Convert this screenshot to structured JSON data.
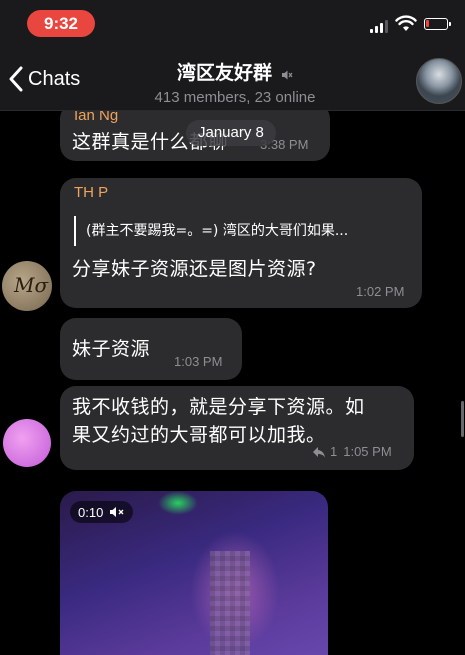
{
  "status_bar": {
    "time": "9:32",
    "battery_color": "#e8463f"
  },
  "nav": {
    "back_label": "Chats",
    "title": "湾区友好群",
    "subtitle": "413 members, 23 online",
    "muted": true
  },
  "chat": {
    "date_label": "January 8",
    "messages": [
      {
        "sender": "Ian Ng",
        "text": "这群真是什么都聊",
        "time": "3:38 PM"
      },
      {
        "sender": "TH P",
        "avatar_text": "Mσ",
        "quote": "(群主不要踢我=。=) 湾区的大哥们如果...",
        "text": "分享妹子资源还是图片资源?",
        "time": "1:02 PM"
      },
      {
        "text": "妹子资源",
        "time": "1:03 PM"
      },
      {
        "text_line1": "我不收钱的，就是分享下资源。如",
        "text_line2": "果又约过的大哥都可以加我。",
        "forward_count": "1",
        "time": "1:05 PM"
      }
    ],
    "video": {
      "duration": "0:10",
      "muted": true
    }
  },
  "colors": {
    "bubble": "#2c2c2e",
    "sender_name": "#f0a35c",
    "meta_text": "#8e8e93",
    "background": "#000000"
  }
}
